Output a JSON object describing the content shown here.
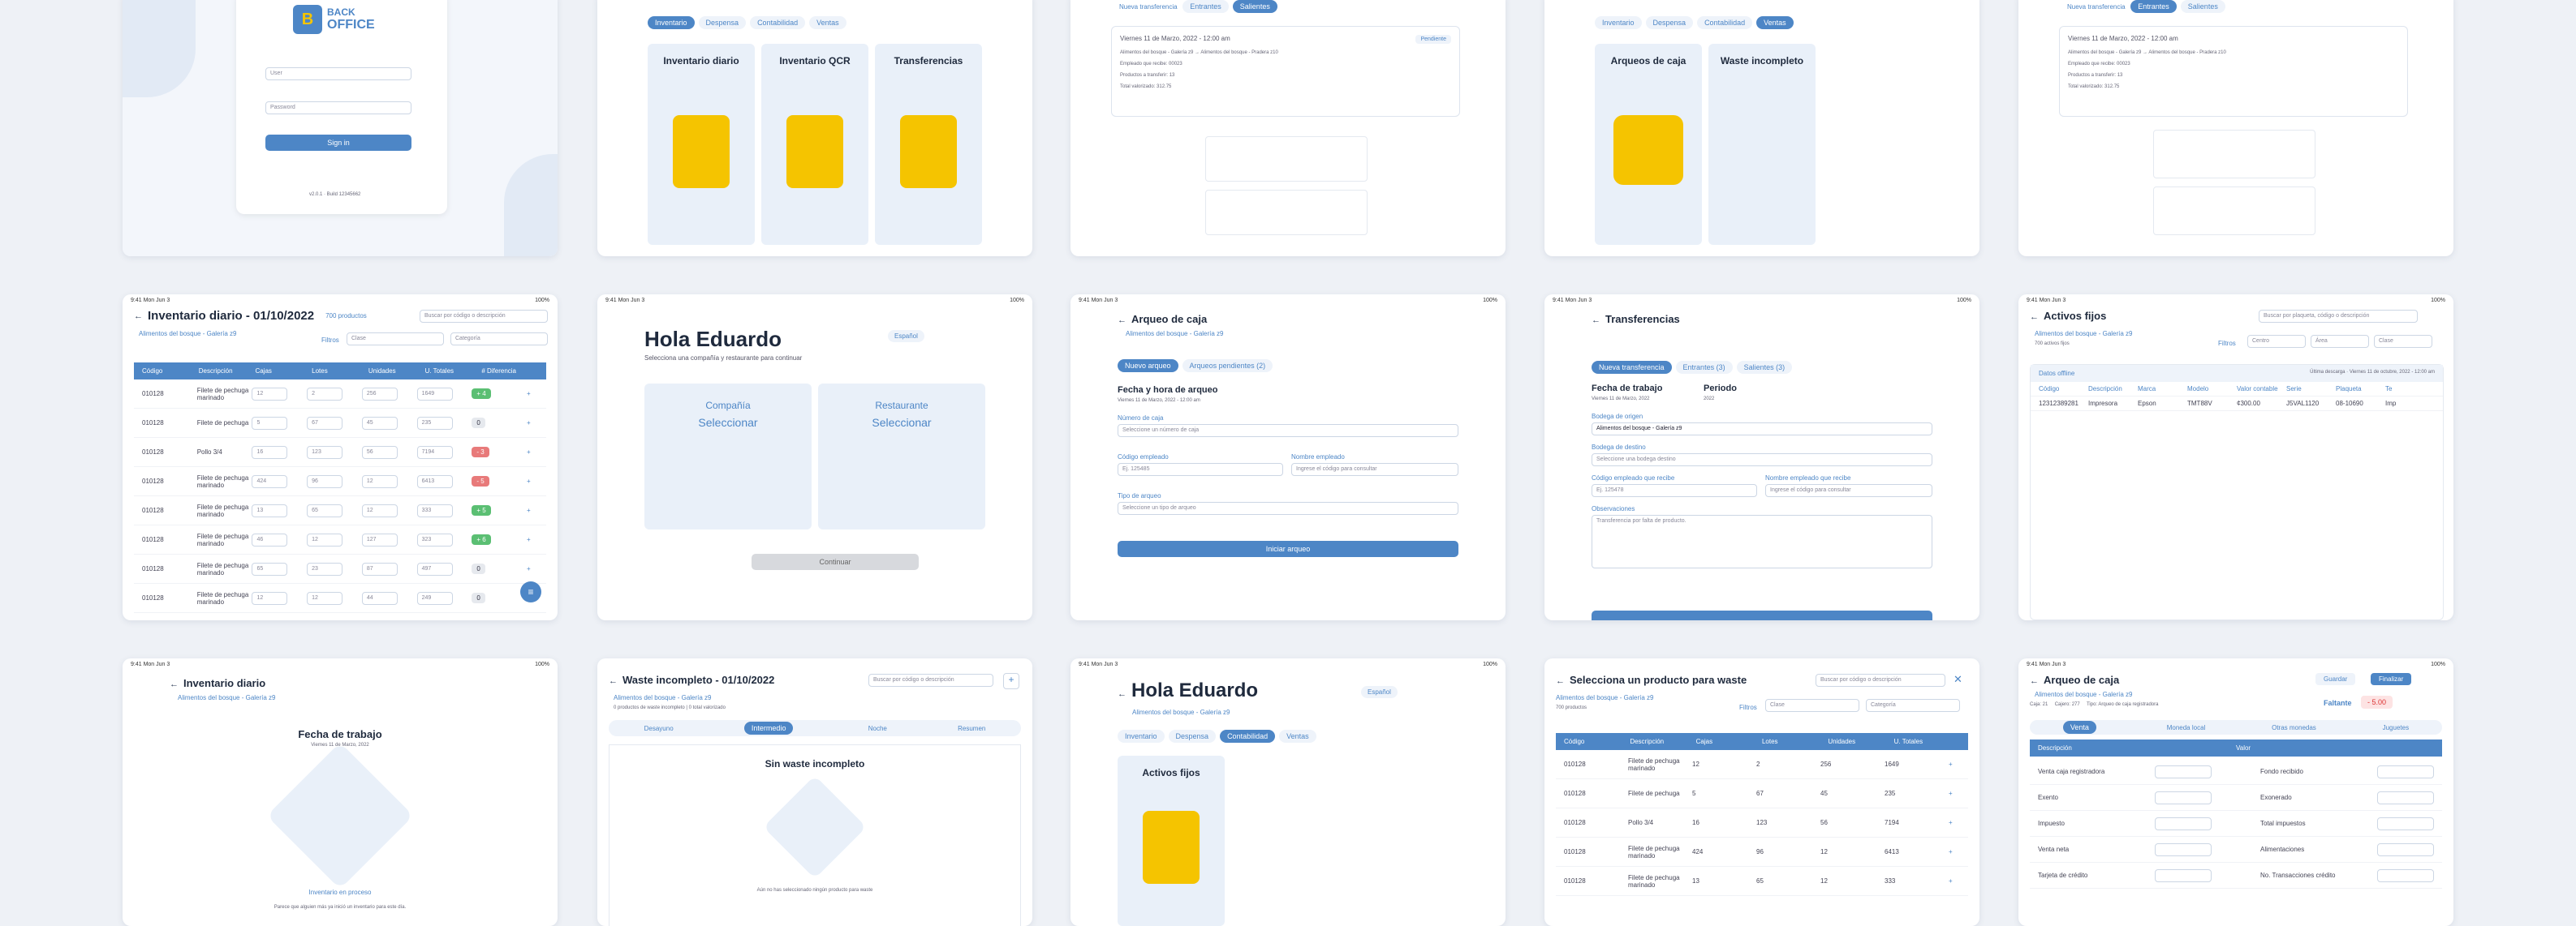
{
  "login": {
    "brand": "BACK",
    "brand2": "OFFICE",
    "user": "User",
    "password": "Password",
    "signin": "Sign in",
    "version": "v2.0.1 · Build 12345662"
  },
  "home_tabs": {
    "tabs": [
      "Inventario",
      "Despensa",
      "Contabilidad",
      "Ventas"
    ],
    "tiles": [
      "Inventario diario",
      "Inventario QCR",
      "Transferencias"
    ]
  },
  "transfer_top": {
    "tab1": "Nueva transferencia",
    "tab2": "Entrantes",
    "tab3": "Salientes",
    "date": "Viernes 11 de Marzo, 2022 - 12:00 am",
    "status": "Pendiente",
    "from": "Alimentos del bosque - Galería z9",
    "to": "Alimentos del bosque - Pradera z10",
    "l1": "Empleado que recibe: 00023",
    "l2": "Productos a transferir: 13",
    "l3": "Total valorizado: 312.75"
  },
  "ventas": {
    "tabs": [
      "Inventario",
      "Despensa",
      "Contabilidad",
      "Ventas"
    ],
    "tiles": [
      "Arqueos de caja",
      "Waste incompleto"
    ]
  },
  "salientes": {
    "tab1": "Nueva transferencia",
    "tab2": "Entrantes",
    "tab3": "Salientes",
    "date": "Viernes 11 de Marzo, 2022 - 12:00 am",
    "from": "Alimentos del bosque - Galería z9",
    "to": "Alimentos del bosque - Pradera z10",
    "l1": "Empleado que recibe: 00023",
    "l2": "Productos a transferir: 13",
    "l3": "Total valorizado: 312.75"
  },
  "inv": {
    "title": "Inventario diario - 01/10/2022",
    "count": "700 productos",
    "search": "Buscar por código o descripción",
    "store": "Alimentos del bosque - Galería z9",
    "filtros": "Filtros",
    "clase": "Clase",
    "categoria": "Categoría",
    "headers": [
      "Código",
      "Descripción",
      "Cajas",
      "Lotes",
      "Unidades",
      "U. Totales",
      "# Diferencia"
    ],
    "rows": [
      [
        "010128",
        "Filete de pechuga marinado",
        "12",
        "2",
        "256",
        "1649",
        "+ 4"
      ],
      [
        "010128",
        "Filete de pechuga",
        "5",
        "67",
        "45",
        "235",
        "0"
      ],
      [
        "010128",
        "Pollo 3/4",
        "16",
        "123",
        "56",
        "7194",
        "- 3"
      ],
      [
        "010128",
        "Filete de pechuga marinado",
        "424",
        "96",
        "12",
        "6413",
        "- 5"
      ],
      [
        "010128",
        "Filete de pechuga marinado",
        "13",
        "65",
        "12",
        "333",
        "+ 5"
      ],
      [
        "010128",
        "Filete de pechuga marinado",
        "46",
        "12",
        "127",
        "323",
        "+ 6"
      ],
      [
        "010128",
        "Filete de pechuga marinado",
        "65",
        "23",
        "87",
        "497",
        "0"
      ],
      [
        "010128",
        "Filete de pechuga marinado",
        "12",
        "12",
        "44",
        "249",
        "0"
      ]
    ]
  },
  "hola": {
    "title": "Hola Eduardo",
    "sub": "Selecciona una compañía y restaurante para continuar",
    "lang": "Español",
    "t1": "Compañía",
    "t1b": "Seleccionar",
    "t2": "Restaurante",
    "t2b": "Seleccionar",
    "btn": "Continuar"
  },
  "arqueo": {
    "title": "Arqueo de caja",
    "store": "Alimentos del bosque - Galería z9",
    "tab1": "Nuevo arqueo",
    "tab2": "Arqueos pendientes",
    "tab2n": "2",
    "h": "Fecha y hora de arqueo",
    "date": "Viernes 11 de Marzo, 2022 - 12:00 am",
    "f1": "Número de caja",
    "f1p": "Seleccione un número de caja",
    "f2": "Código empleado",
    "f2p": "Ej. 125485",
    "f3": "Nombre empleado",
    "f3p": "Ingrese el código para consultar",
    "f4": "Tipo de arqueo",
    "f4p": "Seleccione un tipo de arqueo",
    "btn": "Iniciar arqueo"
  },
  "transf": {
    "title": "Transferencias",
    "tab1": "Nueva transferencia",
    "tab2": "Entrantes",
    "tab2n": "3",
    "tab3": "Salientes",
    "tab3n": "3",
    "h1": "Fecha de trabajo",
    "d1": "Viernes 11 de Marzo, 2022",
    "h2": "Periodo",
    "d2": "2022",
    "f1": "Bodega de origen",
    "f1v": "Alimentos del bosque - Galería z9",
    "f2": "Bodega de destino",
    "f2p": "Seleccione una bodega destino",
    "f3": "Código empleado que recibe",
    "f3p": "Ej. 125478",
    "f4": "Nombre empleado que recibe",
    "f4p": "Ingrese el código para consultar",
    "f5": "Observaciones",
    "f5p": "Transferencia por falta de producto."
  },
  "activos": {
    "title": "Activos fijos",
    "search": "Buscar por plaqueta, código o descripción",
    "store": "Alimentos del bosque - Galería z9",
    "count": "700 activos fijos",
    "filtros": "Filtros",
    "f1": "Centro",
    "f2": "Área",
    "f3": "Clase",
    "offline": "Datos offline",
    "last": "Última descarga",
    "lastd": "Viernes 11 de octubre, 2022 - 12:00 am",
    "headers": [
      "Código",
      "Descripción",
      "Marca",
      "Modelo",
      "Valor contable",
      "Serie",
      "Plaqueta",
      "Te"
    ],
    "row": [
      "12312389281",
      "Impresora",
      "Epson",
      "TMT88V",
      "¢300.00",
      "J5VAL1120",
      "08-10690",
      "Imp"
    ]
  },
  "inv2": {
    "title": "Inventario diario",
    "store": "Alimentos del bosque - Galería z9",
    "h": "Fecha de trabajo",
    "d": "Viernes 11 de Marzo, 2022",
    "status": "Inventario en proceso",
    "msg": "Parece que alguien más ya inició un inventario para este día."
  },
  "waste": {
    "title": "Waste incompleto - 01/10/2022",
    "search": "Buscar por código o descripción",
    "store": "Alimentos del bosque - Galería z9",
    "count": "0 productos de waste incompleto | 0 total valorizado",
    "tabs": [
      "Desayuno",
      "Intermedio",
      "Noche",
      "Resumen"
    ],
    "h": "Sin waste incompleto",
    "msg": "Aún no has seleccionado ningún producto para waste"
  },
  "hola2": {
    "title": "Hola Eduardo",
    "lang": "Español",
    "store": "Alimentos del bosque - Galería z9",
    "tabs": [
      "Inventario",
      "Despensa",
      "Contabilidad",
      "Ventas"
    ],
    "tile": "Activos fijos"
  },
  "sel": {
    "title": "Selecciona un producto para waste",
    "search": "Buscar por código o descripción",
    "store": "Alimentos del bosque - Galería z9",
    "count": "700 productos",
    "filtros": "Filtros",
    "clase": "Clase",
    "categoria": "Categoría",
    "headers": [
      "Código",
      "Descripción",
      "Cajas",
      "Lotes",
      "Unidades",
      "U. Totales"
    ],
    "rows": [
      [
        "010128",
        "Filete de pechuga marinado",
        "12",
        "2",
        "256",
        "1649"
      ],
      [
        "010128",
        "Filete de pechuga",
        "5",
        "67",
        "45",
        "235"
      ],
      [
        "010128",
        "Pollo 3/4",
        "16",
        "123",
        "56",
        "7194"
      ],
      [
        "010128",
        "Filete de pechuga marinado",
        "424",
        "96",
        "12",
        "6413"
      ],
      [
        "010128",
        "Filete de pechuga marinado",
        "13",
        "65",
        "12",
        "333"
      ]
    ]
  },
  "arqueo2": {
    "title": "Arqueo de caja",
    "store": "Alimentos del bosque - Galería z9",
    "b1": "Guardar",
    "b2": "Finalizar",
    "caja": "Caja: 21",
    "cajero": "Cajero: 277",
    "tipo": "Tipo: Arqueo de caja registradora",
    "falt": "Faltante",
    "faltv": "- 5.00",
    "tabs": [
      "Venta",
      "Moneda local",
      "Otras monedas",
      "Juguetes"
    ],
    "h1": "Descripción",
    "h2": "Valor",
    "left": [
      "Venta caja registradora",
      "Exento",
      "Impuesto",
      "Venta neta",
      "Tarjeta de crédito"
    ],
    "right": [
      "Fondo recibido",
      "Exonerado",
      "Total impuestos",
      "Alimentaciones",
      "No. Transacciones crédito"
    ]
  },
  "status": {
    "time": "9:41 Mon Jun 3",
    "batt": "100%"
  }
}
